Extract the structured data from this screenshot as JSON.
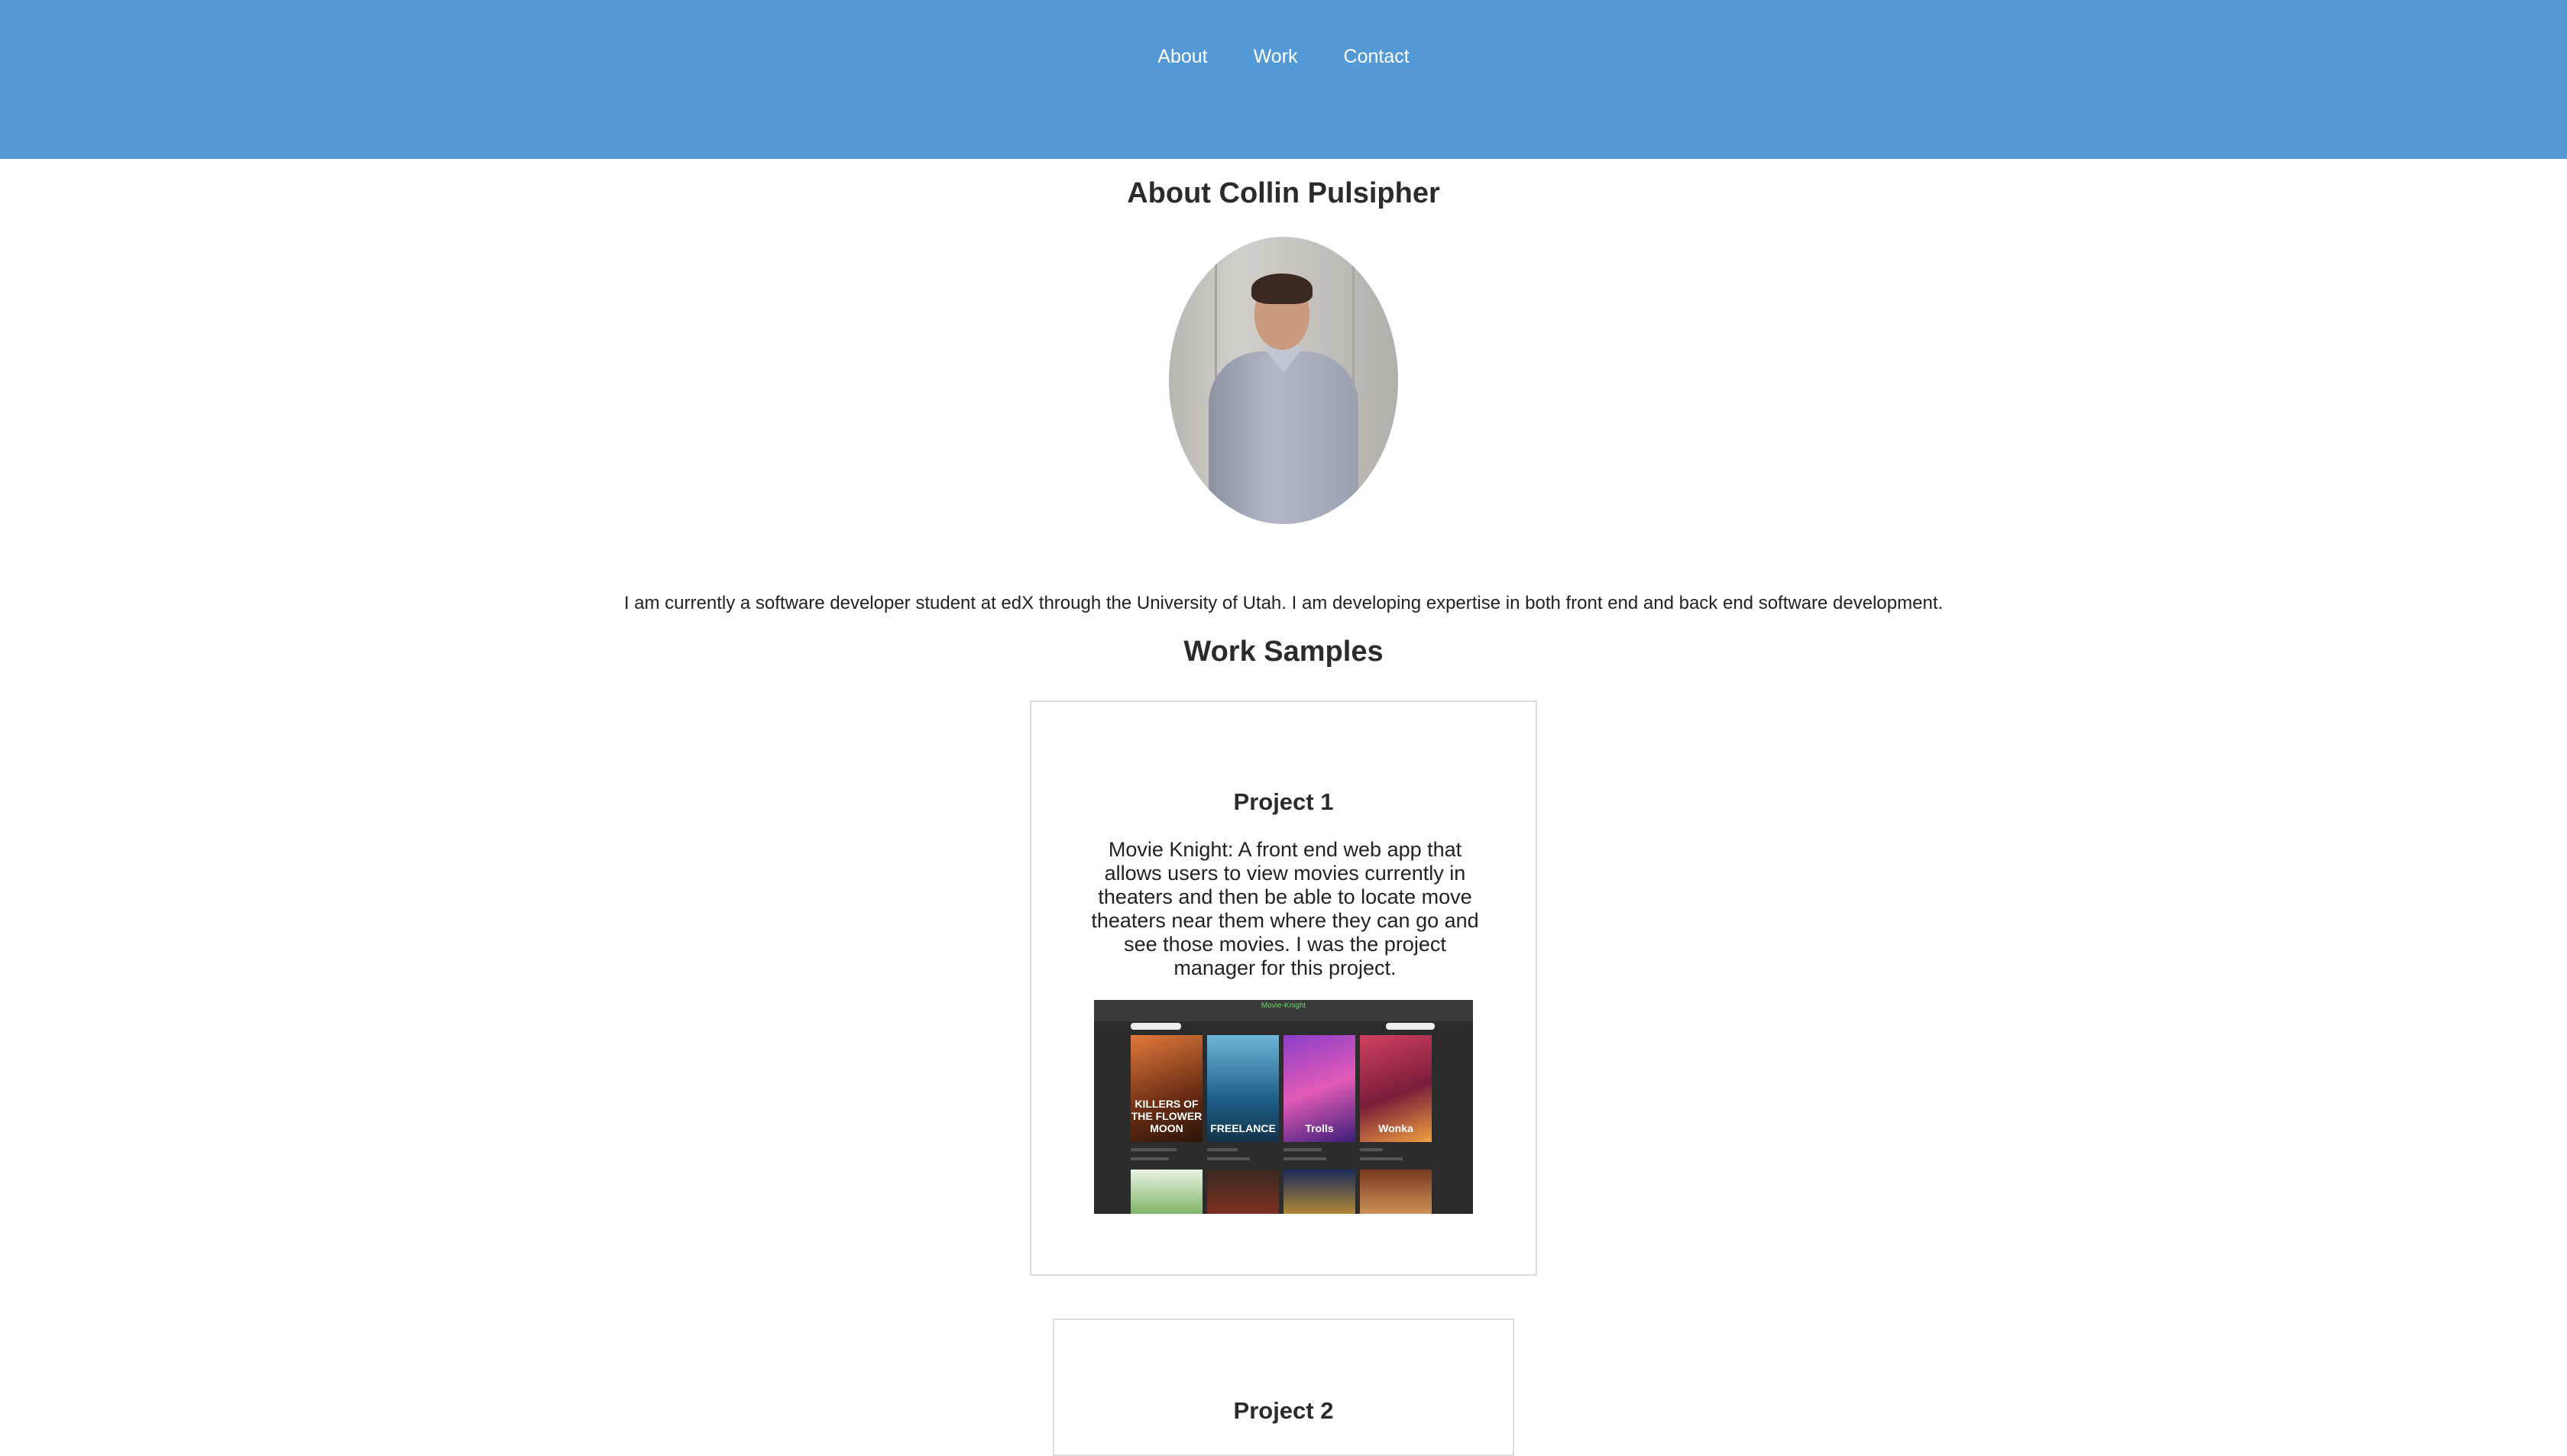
{
  "nav": {
    "items": [
      {
        "label": "About"
      },
      {
        "label": "Work"
      },
      {
        "label": "Contact"
      }
    ]
  },
  "about": {
    "title": "About Collin Pulsipher",
    "bio": "I am currently a software developer student at edX through the University of Utah. I am developing expertise in both front end and back end software development."
  },
  "work": {
    "title": "Work Samples",
    "projects": [
      {
        "title": "Project 1",
        "description": "Movie Knight: A front end web app that allows users to view movies currently in theaters and then be able to locate move theaters near them where they can go and see those movies. I was the project manager for this project.",
        "screenshot": {
          "brand": "Movie-Knight",
          "posters": [
            "KILLERS OF THE FLOWER MOON",
            "FREELANCE",
            "Trolls",
            "Wonka"
          ]
        }
      },
      {
        "title": "Project 2"
      }
    ]
  },
  "colors": {
    "header": "#5399d6",
    "text": "#2b2b2b"
  }
}
